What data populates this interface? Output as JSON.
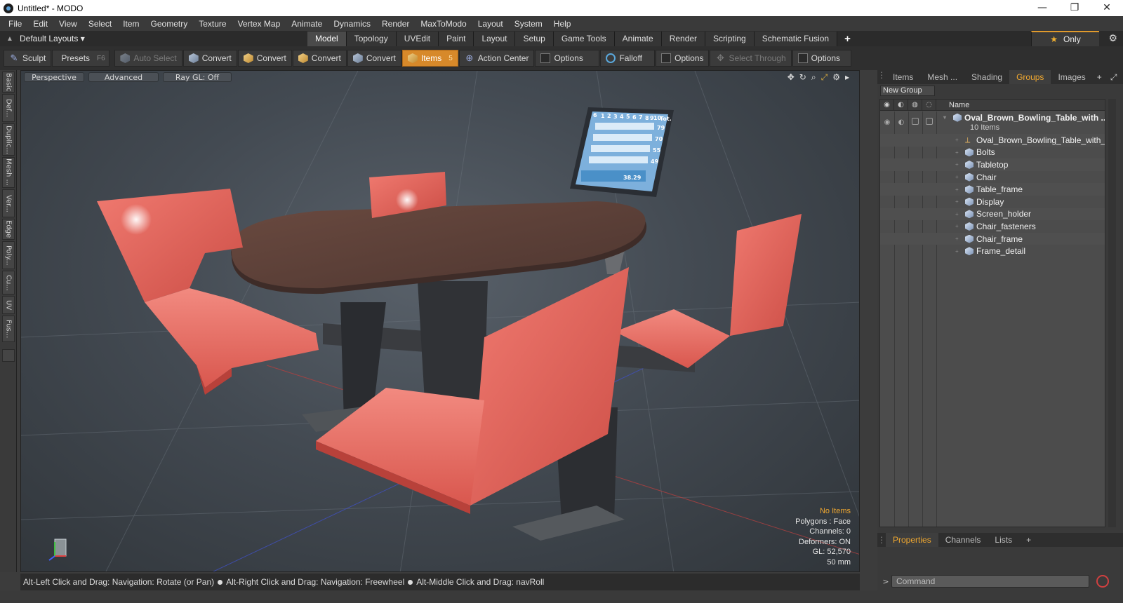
{
  "window": {
    "title": "Untitled* - MODO",
    "minimize": "—",
    "maximize": "❐",
    "close": "✕"
  },
  "menu": [
    "File",
    "Edit",
    "View",
    "Select",
    "Item",
    "Geometry",
    "Texture",
    "Vertex Map",
    "Animate",
    "Dynamics",
    "Render",
    "MaxToModo",
    "Layout",
    "System",
    "Help"
  ],
  "layoutbar": {
    "layouts": "Default Layouts ▾",
    "tabs": [
      "Model",
      "Topology",
      "UVEdit",
      "Paint",
      "Layout",
      "Setup",
      "Game Tools",
      "Animate",
      "Render",
      "Scripting",
      "Schematic Fusion"
    ],
    "active_tab": "Model",
    "add": "+",
    "only": "Only"
  },
  "toolbar": {
    "sculpt": "Sculpt",
    "presets": "Presets",
    "presets_key": "F6",
    "auto_select": "Auto Select",
    "convert1": "Convert",
    "convert2": "Convert",
    "convert3": "Convert",
    "convert4": "Convert",
    "items": "Items",
    "items_key": "5",
    "action_center": "Action Center",
    "options1": "Options",
    "falloff": "Falloff",
    "options2": "Options",
    "select_through": "Select Through",
    "options3": "Options"
  },
  "lefttabs": [
    "Basic",
    "Def...",
    "Duplic...",
    "Mesh ...",
    "Ver...",
    "Edge",
    "Poly...",
    "Cu...",
    "UV",
    "Fus..."
  ],
  "viewport": {
    "view": "Perspective",
    "mode": "Advanced",
    "raygl": "Ray GL: Off",
    "stats": {
      "selection": "No Items",
      "polygons": "Polygons : Face",
      "channels": "Channels: 0",
      "deformers": "Deformers: ON",
      "gl": "GL: 52,570",
      "units": "50 mm"
    },
    "screen_headers": [
      "6",
      "1",
      "2",
      "3",
      "4",
      "5",
      "6",
      "7",
      "8",
      "9",
      "10",
      "Tot."
    ],
    "screen_scores": [
      "79",
      "70",
      "55",
      "49"
    ],
    "screen_total": "38.29"
  },
  "status": {
    "hints": [
      "Alt-Left Click and Drag: Navigation: Rotate (or Pan)",
      "Alt-Right Click and Drag: Navigation: Freewheel",
      "Alt-Middle Click and Drag: navRoll"
    ]
  },
  "rightpanel": {
    "tabs": [
      "Items",
      "Mesh ...",
      "Shading",
      "Groups",
      "Images"
    ],
    "active_tab": "Groups",
    "add": "+",
    "new_group": "New Group",
    "name_header": "Name",
    "group": {
      "name": "Oval_Brown_Bowling_Table_with ...",
      "count": "10 Items"
    },
    "items": [
      "Oval_Brown_Bowling_Table_with_Re...",
      "Bolts",
      "Tabletop",
      "Chair",
      "Table_frame",
      "Display",
      "Screen_holder",
      "Chair_fasteners",
      "Chair_frame",
      "Frame_detail"
    ],
    "bottom_tabs": [
      "Properties",
      "Channels",
      "Lists"
    ],
    "bottom_active": "Properties",
    "command_placeholder": "Command"
  },
  "colors": {
    "accent": "#f0a830",
    "chair": "#e06258",
    "table": "#5a4038",
    "viewport_bg": "#4a5159"
  }
}
